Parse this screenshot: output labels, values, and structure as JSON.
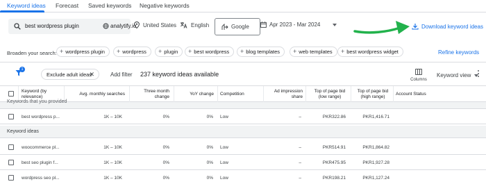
{
  "tabs": [
    {
      "label": "Keyword ideas",
      "active": true
    },
    {
      "label": "Forecast",
      "active": false
    },
    {
      "label": "Saved keywords",
      "active": false
    },
    {
      "label": "Negative keywords",
      "active": false
    }
  ],
  "search": {
    "query": "best wordpress plugin",
    "url_domain": "analytify.io"
  },
  "location": "United States",
  "language": "English",
  "search_engine": "Google",
  "date_range": "Apr 2023 - Mar 2024",
  "download_label": "Download keyword ideas",
  "annotation_color": "#22b24c",
  "accent_color": "#1a73e8",
  "broaden": {
    "label": "Broaden your search:",
    "chips": [
      "wordpress plugin",
      "wordpress",
      "plugin",
      "best wordpress",
      "blog templates",
      "web templates",
      "best wordpress widget"
    ],
    "refine_label": "Refine keywords"
  },
  "filters": {
    "badge_count": "1",
    "exclude_chip": "Exclude adult ideas",
    "add_filter": "Add filter",
    "available": "237 keyword ideas available",
    "columns_label": "Columns",
    "keyword_view": "Keyword view"
  },
  "table": {
    "headers": {
      "keyword": "Keyword (by relevance)",
      "avg_monthly": "Avg. monthly searches",
      "three_month": "Three month change",
      "yoy": "YoY change",
      "competition": "Competition",
      "ad_share": "Ad impression share",
      "bid_low": "Top of page bid (low range)",
      "bid_high": "Top of page bid (high range)",
      "account_status": "Account Status"
    },
    "section_provided": "Keywords that you provided",
    "provided_rows": [
      {
        "keyword": "best wordpress p...",
        "avg": "1K – 10K",
        "three": "0%",
        "yoy": "0%",
        "comp": "Low",
        "share": "–",
        "low": "PKR322.86",
        "high": "PKR1,416.71"
      }
    ],
    "section_ideas": "Keyword ideas",
    "idea_rows": [
      {
        "keyword": "woocommerce pl...",
        "avg": "1K – 10K",
        "three": "0%",
        "yoy": "0%",
        "comp": "Low",
        "share": "–",
        "low": "PKR514.91",
        "high": "PKR1,864.82"
      },
      {
        "keyword": "best seo plugin f...",
        "avg": "1K – 10K",
        "three": "0%",
        "yoy": "0%",
        "comp": "Low",
        "share": "–",
        "low": "PKR475.95",
        "high": "PKR1,927.28"
      },
      {
        "keyword": "wordpress seo pl...",
        "avg": "1K – 10K",
        "three": "0%",
        "yoy": "0%",
        "comp": "Low",
        "share": "–",
        "low": "PKR198.21",
        "high": "PKR1,127.24"
      }
    ]
  }
}
